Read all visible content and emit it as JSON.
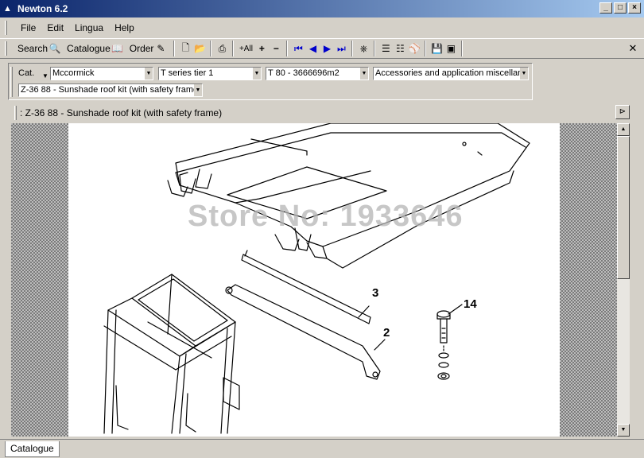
{
  "window": {
    "title": "Newton 6.2"
  },
  "menu": {
    "items": [
      "File",
      "Edit",
      "Lingua",
      "Help"
    ]
  },
  "toolbar": {
    "search_label": "Search",
    "catalogue_label": "Catalogue",
    "order_label": "Order",
    "add_all_label": "All"
  },
  "selectors": {
    "cat_label": "Cat.",
    "brand": "Mccormick",
    "series": "T series tier 1",
    "model": "T 80 - 3666696m2",
    "group": "Accessories and application miscellane",
    "part": "Z-36 88 - Sunshade roof kit (with safety frame"
  },
  "path": {
    "text": ": Z-36 88 - Sunshade roof kit (with safety frame)"
  },
  "drawing": {
    "watermark": "Store No: 1933646",
    "callouts": [
      "3",
      "2",
      "14"
    ]
  },
  "tabs": {
    "active": "Catalogue"
  }
}
